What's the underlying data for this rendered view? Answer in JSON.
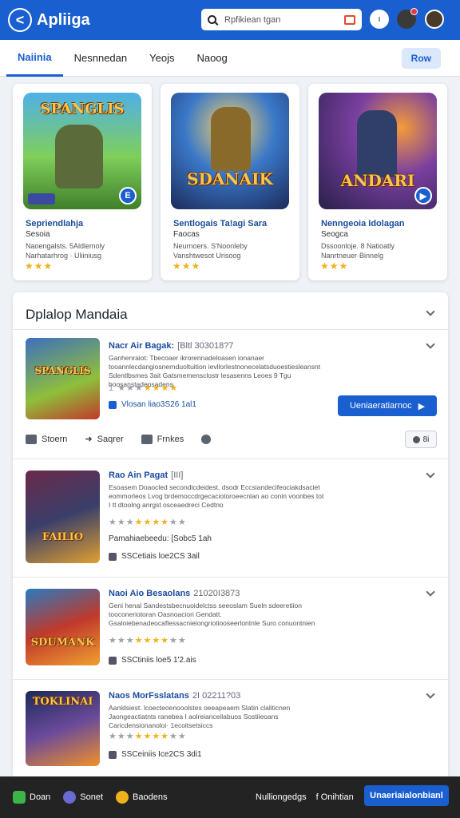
{
  "header": {
    "brand": "Apliiga",
    "logo_glyph": "<",
    "search_placeholder": "Rpfikiean tgan",
    "profile_glyph": "ı"
  },
  "tabs": {
    "items": [
      "Naiinia",
      "Nesnnedan",
      "Yeojs",
      "Naoog"
    ],
    "action_label": "Row"
  },
  "featured": [
    {
      "title": "Sepriendlahja",
      "subtitle": "Sesoia",
      "desc_1": "Naoengalsts. 5Aldlemoly",
      "desc_2": "Narhatarhrog · Uliiniusg",
      "stars": "★★★",
      "art": "SPANGLIS",
      "badge": "E"
    },
    {
      "title": "Sentlogais Ta!agi Sara",
      "subtitle": "Faocas",
      "desc_1": "Neurnoers. S'Noonleby",
      "desc_2": "Vanshtwesot Urisoog",
      "stars": "★★★",
      "art": "SDANAIK",
      "badge": ""
    },
    {
      "title": "Nenngeoia Idolagan",
      "subtitle": "Seogca",
      "desc_1": "Dssoonloje. 8 Natioatly",
      "desc_2": "Nanrtneuer·Binnelg",
      "stars": "★★★",
      "art": "ANDARI",
      "badge": "▶"
    }
  ],
  "list": {
    "title": "Dplalop Mandaia",
    "items": [
      {
        "title": "Nacr Air Bagak:",
        "date": "[Bltl 303018?7",
        "desc": "Ganhenraiot: Tbecoaer ikrorennadeloasen ionanaer tooannlecdangiosnernduoltuition ievllorlestnonecelatsduoestiesleansnt Sdentlbsmes 3ait Gatsmemensclostr lesasenns Leoes 9 Tgu boosanstadeosadens",
        "stars_full": 4,
        "stars_empty": 3,
        "rating": "1",
        "meta": "Vlosan liao3S26 1al1",
        "install": "Ueniaeratiarnoc",
        "actions": [
          "Stoern",
          "Saqrer",
          "Frnkes"
        ],
        "chip": "8i",
        "art": "SPANGLIS"
      },
      {
        "title": "Rao Ain Pagat",
        "date": "[III]",
        "desc": "Esoasem Doaocled secondicdeidest. dsodr Eccsiandecifeociakdsaciet eommorleos Lvog brdemoccdrgecaciotoroeecnlan ao conin voonbes tot I tt dtoolng anrgst osceaedreci Cedtno",
        "stars_full": 4,
        "stars_empty": 5,
        "meta_top": "Pamahiaebeedu: [Sobc5 1ah",
        "meta": "SSCetiais loe2CS 3ail",
        "art": "FAILIO"
      },
      {
        "title": "Naoi Aio Besaolans",
        "date": "21020I3873",
        "desc": "Geni henal Sandestsbecnuoidelctss seeoslam Sueln sdeeretiion tooconeriotoran Oasnoacion Gendatt. Gsaloiebenadeocaflessacnieiongriotiooseerlontnle Suro conuontnien",
        "stars_full": 4,
        "stars_empty": 5,
        "meta": "SSCtiniis loe5 1'2.ais",
        "art": "SDUMANK"
      },
      {
        "title": "Naos MorFsslatans",
        "date": "2I 02211?03",
        "desc": "Aanldsiest. lcoecteoenooolstes oeeapeaem Slatin claliticnen Jaongeactiatnts ranebea I aolreianceilabuos Sostiieoans Caricdensionanoloi· 1ecoitsetsiccs",
        "stars_full": 4,
        "stars_empty": 5,
        "meta": "SSCeiniis Ice2CS 3di1",
        "art": "TOKLINAI"
      }
    ]
  },
  "bottom_bar": {
    "items": [
      "Doan",
      "Sonet",
      "Baodens"
    ],
    "right_links": [
      "Nulliongedgs",
      "f Onihtian"
    ],
    "cta": "Unaeriaialonbianl"
  },
  "colors": {
    "accent": "#1a5fd0",
    "header_bg": "#1a5fd0",
    "star": "#f0b21a",
    "bottom_bg": "#232323"
  }
}
